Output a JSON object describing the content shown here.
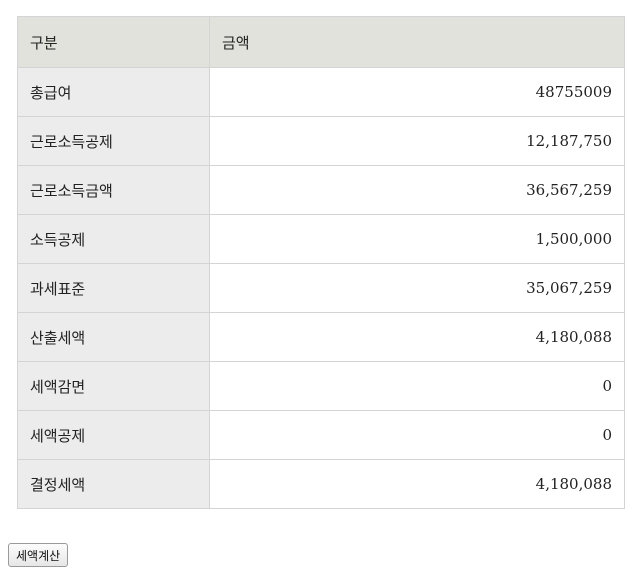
{
  "table": {
    "headers": [
      "구분",
      "금액"
    ],
    "rows": [
      {
        "label": "총급여",
        "amount": "48755009"
      },
      {
        "label": "근로소득공제",
        "amount": "12,187,750"
      },
      {
        "label": "근로소득금액",
        "amount": "36,567,259"
      },
      {
        "label": "소득공제",
        "amount": "1,500,000"
      },
      {
        "label": "과세표준",
        "amount": "35,067,259"
      },
      {
        "label": "산출세액",
        "amount": "4,180,088"
      },
      {
        "label": "세액감면",
        "amount": "0"
      },
      {
        "label": "세액공제",
        "amount": "0"
      },
      {
        "label": "결정세액",
        "amount": "4,180,088"
      }
    ]
  },
  "actions": {
    "calculate_label": "세액계산"
  }
}
